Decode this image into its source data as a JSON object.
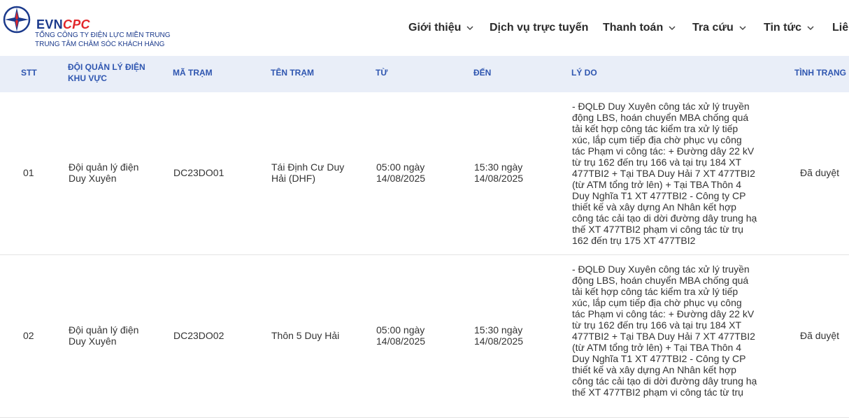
{
  "brand": {
    "evn": "EVN",
    "cpc": "CPC",
    "line1": "TỔNG CÔNG TY ĐIỆN LỰC MIỀN TRUNG",
    "line2": "TRUNG TÂM CHĂM SÓC KHÁCH HÀNG"
  },
  "nav": {
    "items": [
      {
        "label": "Giới thiệu"
      },
      {
        "label": "Dịch vụ trực tuyến"
      },
      {
        "label": "Thanh toán"
      },
      {
        "label": "Tra cứu"
      },
      {
        "label": "Tin tức"
      },
      {
        "label": "Liê"
      }
    ]
  },
  "table": {
    "headers": {
      "stt": "STT",
      "doi_line1": "ĐỘI QUẢN LÝ ĐIỆN",
      "doi_line2": "KHU VỰC",
      "ma_tram": "MÃ TRẠM",
      "ten_tram": "TÊN TRẠM",
      "tu": "TỪ",
      "den": "ĐẾN",
      "ly_do": "LÝ DO",
      "tinh_trang": "TÌNH TRẠNG"
    },
    "rows": [
      {
        "stt": "01",
        "doi_1": "Đội quản lý điện",
        "doi_2": "Duy Xuyên",
        "ma_tram": "DC23DO01",
        "ten_1": "Tái Định Cư Duy",
        "ten_2": "Hải (DHF)",
        "tu_1": "05:00 ngày",
        "tu_2": "14/08/2025",
        "den_1": "15:30 ngày",
        "den_2": "14/08/2025",
        "ly_do": [
          "- ĐQLĐ Duy Xuyên công tác xử lý truyền",
          "động LBS, hoán chuyển MBA chống quá",
          "tải kết hợp công tác kiểm tra xử lý tiếp",
          "xúc, lắp cụm tiếp địa chờ phục vụ công",
          "tác Phạm vi công tác: + Đường dây 22 kV",
          "từ trụ 162 đến trụ 166 và tại trụ 184 XT",
          "477TBI2 + Tại TBA Duy Hải 7 XT 477TBI2",
          "(từ ATM tổng trở lên) + Tại TBA Thôn 4",
          "Duy Nghĩa T1 XT 477TBI2 - Công ty CP",
          "thiết kế và xây dựng An Nhân kết hợp",
          "công tác cải tạo di dời đường dây trung hạ",
          "thế XT 477TBI2 phạm vi công tác từ trụ",
          "162 đến trụ 175 XT 477TBI2"
        ],
        "tinh_trang": "Đã duyệt"
      },
      {
        "stt": "02",
        "doi_1": "Đội quản lý điện",
        "doi_2": "Duy Xuyên",
        "ma_tram": "DC23DO02",
        "ten_1": "Thôn 5 Duy Hải",
        "ten_2": "",
        "tu_1": "05:00 ngày",
        "tu_2": "14/08/2025",
        "den_1": "15:30 ngày",
        "den_2": "14/08/2025",
        "ly_do": [
          "- ĐQLĐ Duy Xuyên công tác xử lý truyền",
          "động LBS, hoán chuyển MBA chống quá",
          "tải kết hợp công tác kiểm tra xử lý tiếp",
          "xúc, lắp cụm tiếp địa chờ phục vụ công",
          "tác Phạm vi công tác: + Đường dây 22 kV",
          "từ trụ 162 đến trụ 166 và tại trụ 184 XT",
          "477TBI2 + Tại TBA Duy Hải 7 XT 477TBI2",
          "(từ ATM tổng trở lên) + Tại TBA Thôn 4",
          "Duy Nghĩa T1 XT 477TBI2 - Công ty CP",
          "thiết kế và xây dựng An Nhân kết hợp",
          "công tác cải tạo di dời đường dây trung hạ",
          "thế XT 477TBI2 phạm vi công tác từ trụ"
        ],
        "tinh_trang": "Đã duyệt"
      }
    ]
  },
  "colors": {
    "brand_blue": "#1b3a8c",
    "brand_red": "#e2262a",
    "header_bg": "#e9eef8",
    "header_text": "#2f56b0"
  }
}
